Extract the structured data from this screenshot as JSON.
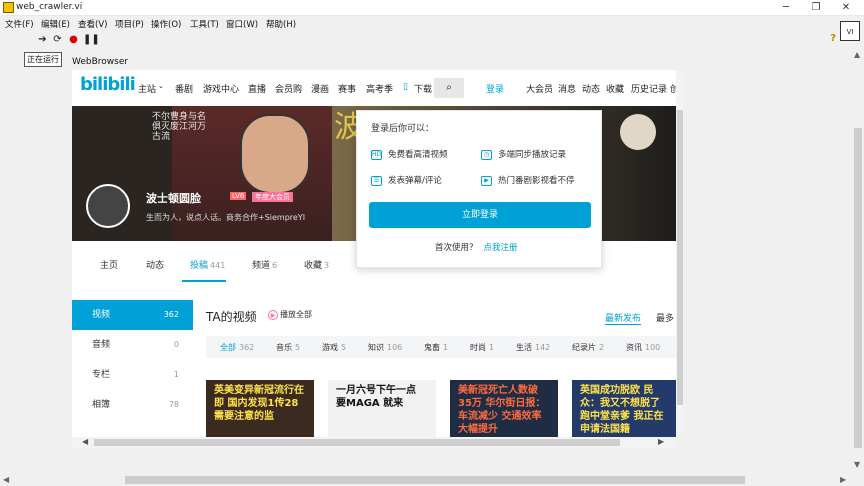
{
  "window": {
    "title": "web_crawler.vi",
    "min": "─",
    "max": "❐",
    "close": "✕"
  },
  "menu": [
    "文件(F)",
    "编辑(E)",
    "查看(V)",
    "项目(P)",
    "操作(O)",
    "工具(T)",
    "窗口(W)",
    "帮助(H)"
  ],
  "toolbar": {
    "tooltip": "正在运行",
    "run_icon": "run-arrow-icon",
    "run_cont_icon": "run-continuous-icon",
    "abort_icon": "abort-icon",
    "pause_icon": "pause-icon",
    "help": "?"
  },
  "panel": {
    "label": "WebBrowser"
  },
  "bili": {
    "logo": "bilibili",
    "nav": [
      "主站",
      "番剧",
      "游戏中心",
      "直播",
      "会员购",
      "漫画",
      "赛事",
      "高考季",
      "下载"
    ],
    "nav_right": [
      "大会员",
      "消息",
      "动态",
      "收藏",
      "历史记录",
      "创"
    ],
    "login": "登录",
    "banner_poem": "不尔曹身与名俱灭废江河万古流",
    "banner_big": "波 圆",
    "user": {
      "name": "波士顿圆脸",
      "level": "LV6",
      "vip": "年度大会员",
      "sign": "生而为人，说点人话。商务合作+SiempreYI"
    },
    "tabs": [
      {
        "label": "主页",
        "count": ""
      },
      {
        "label": "动态",
        "count": ""
      },
      {
        "label": "投稿",
        "count": "441"
      },
      {
        "label": "频道",
        "count": "6"
      },
      {
        "label": "收藏",
        "count": "3"
      }
    ],
    "side": [
      {
        "label": "视频",
        "count": "362"
      },
      {
        "label": "音频",
        "count": "0"
      },
      {
        "label": "专栏",
        "count": "1"
      },
      {
        "label": "相簿",
        "count": "78"
      }
    ],
    "main_title": "TA的视频",
    "play_all": "播放全部",
    "sort": [
      "最新发布",
      "最多"
    ],
    "filters": [
      {
        "label": "全部",
        "count": "362"
      },
      {
        "label": "音乐",
        "count": "5"
      },
      {
        "label": "游戏",
        "count": "5"
      },
      {
        "label": "知识",
        "count": "106"
      },
      {
        "label": "鬼畜",
        "count": "1"
      },
      {
        "label": "时尚",
        "count": "1"
      },
      {
        "label": "生活",
        "count": "142"
      },
      {
        "label": "纪录片",
        "count": "2"
      },
      {
        "label": "资讯",
        "count": "100"
      }
    ],
    "thumbs": [
      "英美变异新冠流行在即 国内发现1传28 需要注意的监",
      "一月六号下午一点 要MAGA 就来",
      "美新冠死亡人数破35万 华尔街日报：车流减少 交通效率大幅提升",
      "英国成功脱欧 民众：我又不想脱了 跑中堂亲爹 我正在申请法国籍"
    ]
  },
  "popup": {
    "title": "登录后你可以：",
    "perks": [
      "免费看高清视频",
      "多端同步播放记录",
      "发表弹幕/评论",
      "热门番剧影视看不停"
    ],
    "perk_icons": [
      "HD",
      "◷",
      "☰",
      "▶"
    ],
    "button": "立即登录",
    "first_use": "首次使用？",
    "register": "点我注册"
  }
}
